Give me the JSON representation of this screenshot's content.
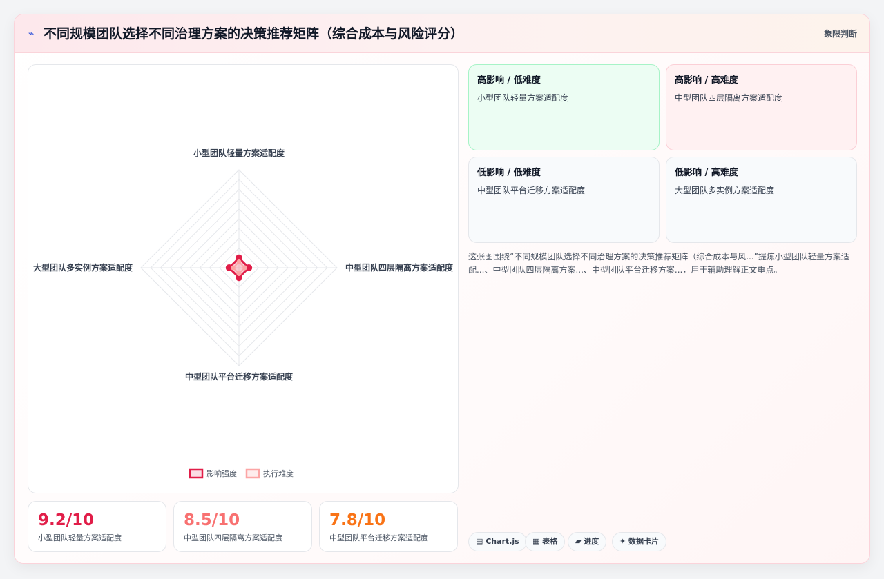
{
  "header": {
    "logo_icon": "chart-line-icon",
    "title": "不同规模团队选择不同治理方案的决策推荐矩阵（综合成本与风险评分）",
    "tag": "象限判断"
  },
  "chart_data": {
    "type": "radar",
    "axes": [
      "小型团队轻量方案适配度",
      "中型团队四层隔离方案适配度",
      "中型团队平台迁移方案适配度",
      "大型团队多实例方案适配度"
    ],
    "series": [
      {
        "name": "影响强度",
        "values": [
          1,
          1,
          1,
          1
        ],
        "color": "#e11d48"
      },
      {
        "name": "执行难度",
        "values": [
          0.6,
          0.6,
          0.6,
          0.6
        ],
        "color": "#fca5a5"
      }
    ],
    "rlim": [
      0,
      10
    ],
    "grid": true,
    "legend": "bottom"
  },
  "kpis": [
    {
      "value": "9.2/10",
      "label": "小型团队轻量方案适配度",
      "color": "#e11d48"
    },
    {
      "value": "8.5/10",
      "label": "中型团队四层隔离方案适配度",
      "color": "#f87171"
    },
    {
      "value": "7.8/10",
      "label": "中型团队平台迁移方案适配度",
      "color": "#f97316"
    }
  ],
  "quadrants": [
    {
      "title": "高影响 / 低难度",
      "body": "小型团队轻量方案适配度"
    },
    {
      "title": "高影响 / 高难度",
      "body": "中型团队四层隔离方案适配度"
    },
    {
      "title": "低影响 / 低难度",
      "body": "中型团队平台迁移方案适配度"
    },
    {
      "title": "低影响 / 高难度",
      "body": "大型团队多实例方案适配度"
    }
  ],
  "description": "这张图围绕“不同规模团队选择不同治理方案的决策推荐矩阵（综合成本与风...”提炼小型团队轻量方案适配...、中型团队四层隔离方案...、中型团队平台迁移方案...，用于辅助理解正文重点。",
  "chips": [
    "▤ Chart.js",
    "▦ 表格",
    "▰ 进度",
    "✦ 数据卡片"
  ]
}
